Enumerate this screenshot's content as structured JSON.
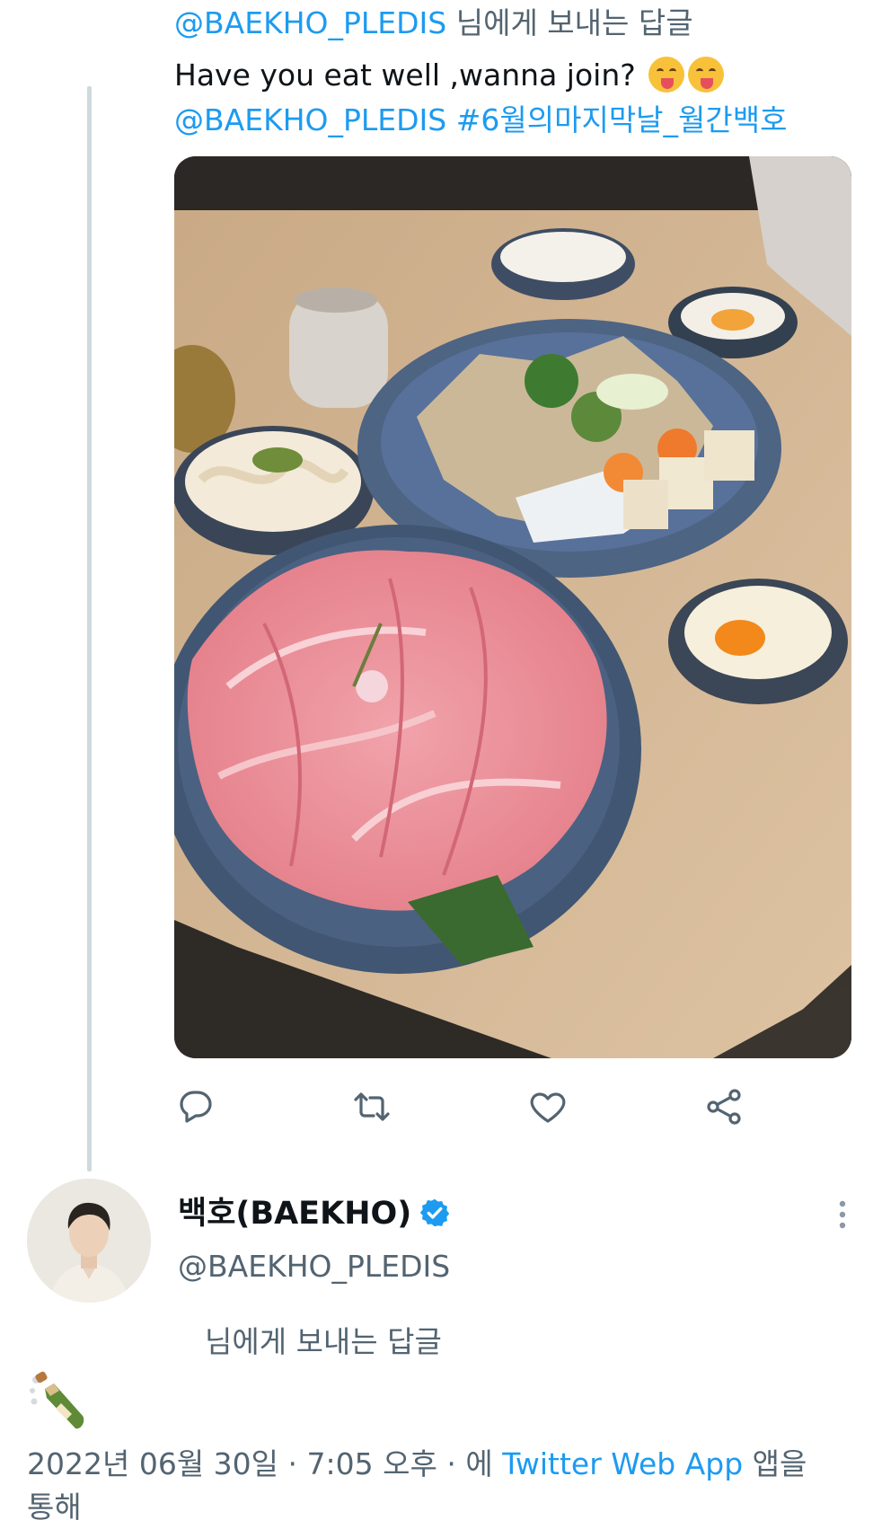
{
  "parent_tweet": {
    "reply_context": {
      "mention": "@BAEKHO_PLEDIS",
      "suffix": " 님에게 보내는 답글"
    },
    "text": "Have you eat well ,wanna join?",
    "emojis": [
      "face-savoring-food-emoji",
      "face-savoring-food-emoji"
    ],
    "mention": "@BAEKHO_PLEDIS",
    "hashtag": "#6월의마지막날_월간백호"
  },
  "actions": [
    "reply-icon",
    "retweet-icon",
    "like-icon",
    "share-icon"
  ],
  "reply_tweet": {
    "display_name": "백호(BAEKHO)",
    "handle": "@BAEKHO_PLEDIS",
    "verified": true,
    "replying_to_suffix": "님에게 보내는 답글",
    "body_emoji": "bottle-with-popping-cork-emoji",
    "timestamp": {
      "date": "2022년 06월 30일",
      "separator1": " · ",
      "time": "7:05 오후",
      "separator2": " · ",
      "via_prefix": "에 ",
      "source": "Twitter Web App",
      "via_suffix": " 앱을 통해"
    }
  },
  "colors": {
    "link": "#1d9bf0",
    "secondary_text": "#536471",
    "primary_text": "#0f1419",
    "thread_line": "#cfd9de"
  }
}
